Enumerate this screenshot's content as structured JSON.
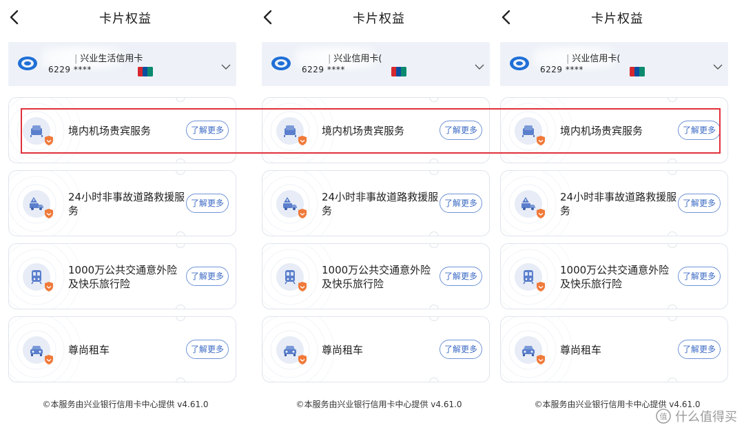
{
  "header": {
    "title": "卡片权益"
  },
  "panels": [
    {
      "card_name": "兴业生活信用卡",
      "card_number": "6229 ****"
    },
    {
      "card_name": "兴业信用卡(",
      "card_number": "6229 ****"
    },
    {
      "card_name": "兴业信用卡(",
      "card_number": "6229 ****"
    }
  ],
  "benefits": [
    {
      "label": "境内机场贵宾服务",
      "icon": "airport-lounge-seat-icon"
    },
    {
      "label": "24小时非事故道路救援服务",
      "icon": "road-rescue-truck-icon"
    },
    {
      "label": "1000万公共交通意外险及快乐旅行险",
      "icon": "train-icon"
    },
    {
      "label": "尊尚租车",
      "icon": "car-icon"
    }
  ],
  "more_label": "了解更多",
  "footer": "©本服务由兴业银行信用卡中心提供 v4.61.0",
  "watermark": "什么值得买",
  "colors": {
    "accent": "#3d6bc4",
    "card_bg": "#eef2f8",
    "highlight": "#e0303a",
    "badge": "#f07a3a"
  }
}
